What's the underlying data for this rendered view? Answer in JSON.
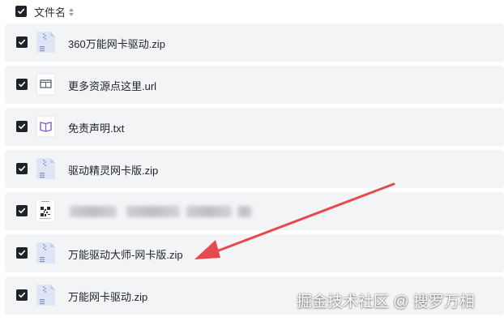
{
  "header": {
    "column_label": "文件名"
  },
  "files": [
    {
      "name": "360万能网卡驱动.zip",
      "type": "zip",
      "checked": true
    },
    {
      "name": "更多资源点这里.url",
      "type": "url",
      "checked": true
    },
    {
      "name": "免责声明.txt",
      "type": "txt",
      "checked": true
    },
    {
      "name": "驱动精灵网卡版.zip",
      "type": "zip",
      "checked": true
    },
    {
      "name": "",
      "type": "qr-image",
      "checked": true
    },
    {
      "name": "万能驱动大师-网卡版.zip",
      "type": "zip",
      "checked": true
    },
    {
      "name": "万能网卡驱动.zip",
      "type": "zip",
      "checked": true
    }
  ],
  "watermark": "掘金技术社区 @ 搜罗万相",
  "colors": {
    "arrow": "#e8484f",
    "row_bg": "#f3f4f6",
    "checkbox": "#1f2329"
  }
}
